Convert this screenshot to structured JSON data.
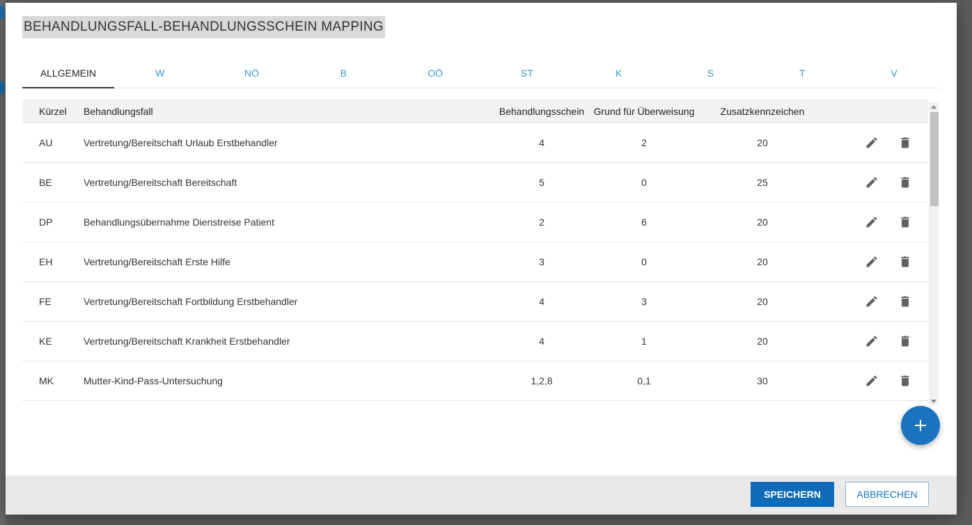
{
  "dialog": {
    "title": "BEHANDLUNGSFALL-BEHANDLUNGSSCHEIN MAPPING"
  },
  "tabs": [
    {
      "label": "ALLGEMEIN",
      "active": true
    },
    {
      "label": "W"
    },
    {
      "label": "NÖ"
    },
    {
      "label": "B"
    },
    {
      "label": "OÖ"
    },
    {
      "label": "ST"
    },
    {
      "label": "K"
    },
    {
      "label": "S"
    },
    {
      "label": "T"
    },
    {
      "label": "V"
    }
  ],
  "table": {
    "headers": {
      "kuerzel": "Kürzel",
      "behandlungsfall": "Behandlungsfall",
      "behandlungsschein": "Behandlungsschein",
      "grund": "Grund für Überweisung",
      "zusatz": "Zusatzkennzeichen"
    },
    "rows": [
      {
        "kuerzel": "AU",
        "behandlungsfall": "Vertretung/Bereitschaft Urlaub Erstbehandler",
        "behandlungsschein": "4",
        "grund": "2",
        "zusatz": "20"
      },
      {
        "kuerzel": "BE",
        "behandlungsfall": "Vertretung/Bereitschaft Bereitschaft",
        "behandlungsschein": "5",
        "grund": "0",
        "zusatz": "25"
      },
      {
        "kuerzel": "DP",
        "behandlungsfall": "Behandlungsübernahme Dienstreise Patient",
        "behandlungsschein": "2",
        "grund": "6",
        "zusatz": "20"
      },
      {
        "kuerzel": "EH",
        "behandlungsfall": "Vertretung/Bereitschaft Erste Hilfe",
        "behandlungsschein": "3",
        "grund": "0",
        "zusatz": "20"
      },
      {
        "kuerzel": "FE",
        "behandlungsfall": "Vertretung/Bereitschaft Fortbildung Erstbehandler",
        "behandlungsschein": "4",
        "grund": "3",
        "zusatz": "20"
      },
      {
        "kuerzel": "KE",
        "behandlungsfall": "Vertretung/Bereitschaft Krankheit Erstbehandler",
        "behandlungsschein": "4",
        "grund": "1",
        "zusatz": "20"
      },
      {
        "kuerzel": "MK",
        "behandlungsfall": "Mutter-Kind-Pass-Untersuchung",
        "behandlungsschein": "1,2,8",
        "grund": "0,1",
        "zusatz": "30"
      }
    ]
  },
  "icons": {
    "edit": "pencil-icon",
    "delete": "trash-icon",
    "add": "plus-icon"
  },
  "footer": {
    "save_label": "SPEICHERN",
    "cancel_label": "ABBRECHEN"
  },
  "colors": {
    "accent": "#1a73be",
    "tab_inactive": "#3a97cf",
    "icon": "#616161"
  }
}
